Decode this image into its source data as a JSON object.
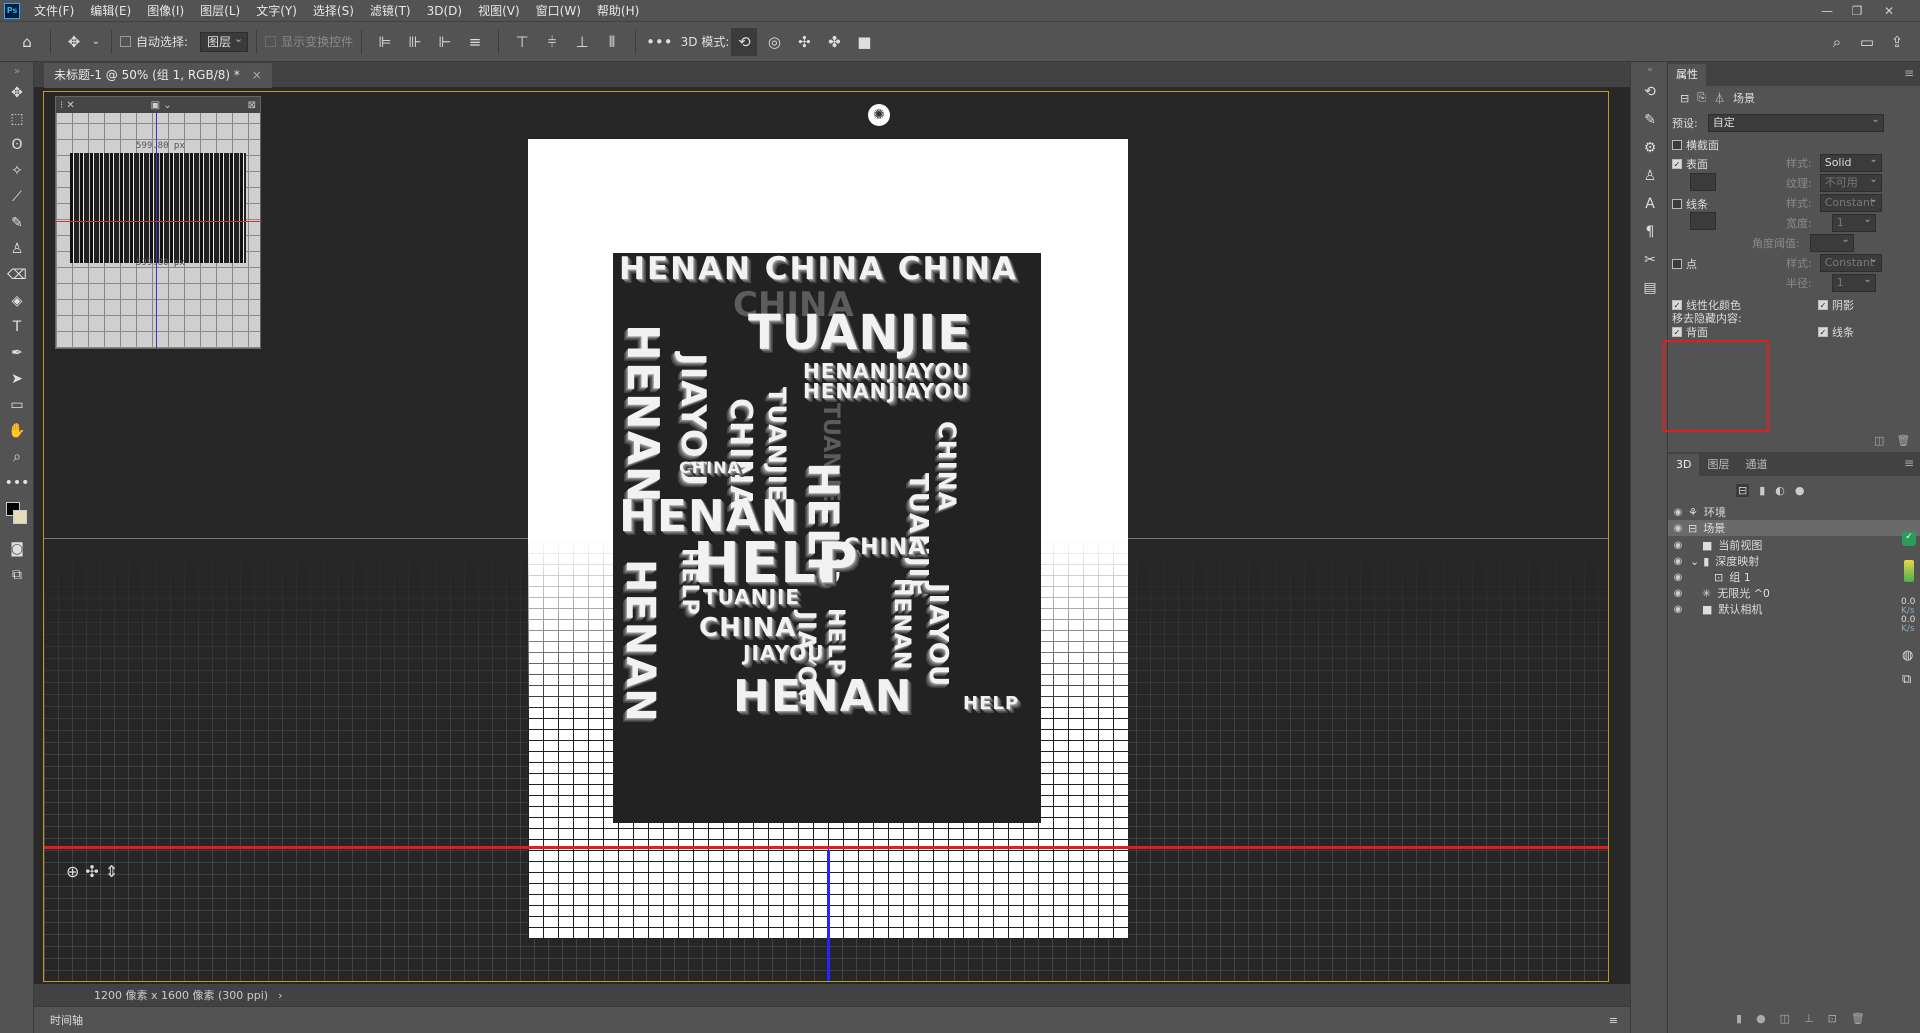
{
  "menubar": {
    "logo": "Ps",
    "items": [
      "文件(F)",
      "编辑(E)",
      "图像(I)",
      "图层(L)",
      "文字(Y)",
      "选择(S)",
      "滤镜(T)",
      "3D(D)",
      "视图(V)",
      "窗口(W)",
      "帮助(H)"
    ]
  },
  "options": {
    "auto_select_label": "自动选择:",
    "auto_select_value": "图层",
    "show_transform_label": "显示变换控件",
    "mode_label": "3D 模式:",
    "more": "•••"
  },
  "document": {
    "tab_title": "未标题-1 @ 50% (组 1, RGB/8) *",
    "status": "1200 像素 x 1600 像素 (300 ppi)",
    "timeline": "时间轴"
  },
  "secondary_view": {
    "label_top": "599.80 px",
    "label_bottom": "599.80 px"
  },
  "artwork": {
    "top": "HENAN CHINA CHINA",
    "w1": "TUANJIE",
    "w2": "HENAN",
    "w3": "JIAYOU",
    "w4": "HENAN",
    "w5": "JIAYOU",
    "w6": "HELP",
    "w7": "CHINA",
    "w8": "HENAN",
    "w9": "HELP",
    "w10": "TUANJIE",
    "w11": "CHINA",
    "w12": "HENAN",
    "w13": "HELP",
    "w14": "JIAYOU",
    "w15": "HENAN",
    "w16": "CHINA",
    "w17": "JIAYOU",
    "w18": "TUANJIE",
    "w19": "HENAN",
    "w20": "HENAN",
    "w21": "HELP",
    "w22": "CHINA",
    "w23": "TUANJIE",
    "w24": "CHINA"
  },
  "properties": {
    "panel_tab": "属性",
    "scene_label": "场景",
    "preset_label": "预设:",
    "preset_value": "自定",
    "cross_section_label": "横截面",
    "surface_label": "表面",
    "surface_checked": true,
    "style_label": "样式:",
    "surface_style": "Solid",
    "texture_label": "纹理:",
    "texture_value": "不可用",
    "lines_label": "线条",
    "lines_style": "Constant",
    "width_label": "宽度:",
    "width_value": "1",
    "angle_label": "角度阈值:",
    "points_label": "点",
    "points_style": "Constant",
    "radius_label": "半径:",
    "radius_value": "1",
    "linearize_label": "线性化颜色",
    "shadow_label": "阴影",
    "remove_hidden_label": "移去隐藏内容:",
    "backface_label": "背面",
    "lines2_label": "线条"
  },
  "layers_panel": {
    "tabs": [
      "3D",
      "图层",
      "通道"
    ],
    "items": [
      {
        "name": "环境",
        "indent": 0
      },
      {
        "name": "场景",
        "indent": 0
      },
      {
        "name": "当前视图",
        "indent": 1
      },
      {
        "name": "深度映射",
        "indent": 1
      },
      {
        "name": "组 1",
        "indent": 2
      },
      {
        "name": "无限光 ^0",
        "indent": 1
      },
      {
        "name": "默认相机",
        "indent": 1
      }
    ],
    "speed1": "0.0",
    "speed1_unit": "K/s",
    "speed2": "0.0",
    "speed2_unit": "K/s"
  },
  "colors": {
    "accent_red": "#e01e1e",
    "axis_blue": "#2426ff",
    "frame_gold": "#bb9b2a"
  }
}
